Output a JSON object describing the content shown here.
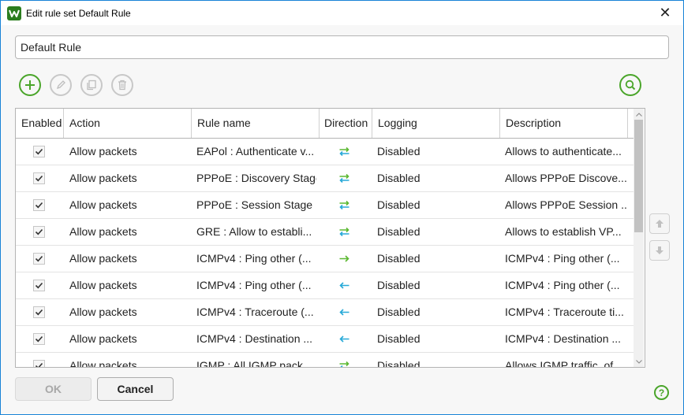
{
  "window": {
    "title": "Edit rule set Default Rule",
    "close_symbol": "✕"
  },
  "rule_set_name": {
    "value": "Default Rule"
  },
  "toolbar": {
    "add_icon": "plus-icon",
    "edit_icon": "pencil-icon",
    "copy_icon": "copy-icon",
    "delete_icon": "trash-icon",
    "search_icon": "search-icon"
  },
  "table": {
    "columns": [
      "Enabled",
      "Action",
      "Rule name",
      "Direction",
      "Logging",
      "Description"
    ],
    "rows": [
      {
        "enabled": true,
        "action": "Allow packets",
        "name": "EAPol : Authenticate v...",
        "direction": "both",
        "logging": "Disabled",
        "description": "Allows to authenticate..."
      },
      {
        "enabled": true,
        "action": "Allow packets",
        "name": "PPPoE : Discovery Stage",
        "direction": "both",
        "logging": "Disabled",
        "description": "Allows PPPoE Discove..."
      },
      {
        "enabled": true,
        "action": "Allow packets",
        "name": "PPPoE : Session Stage",
        "direction": "both",
        "logging": "Disabled",
        "description": "Allows PPPoE Session ..."
      },
      {
        "enabled": true,
        "action": "Allow packets",
        "name": "GRE : Allow to establi...",
        "direction": "both",
        "logging": "Disabled",
        "description": "Allows to establish VP..."
      },
      {
        "enabled": true,
        "action": "Allow packets",
        "name": "ICMPv4 : Ping other (...",
        "direction": "outgoing",
        "logging": "Disabled",
        "description": "ICMPv4 : Ping other (..."
      },
      {
        "enabled": true,
        "action": "Allow packets",
        "name": "ICMPv4 : Ping other (...",
        "direction": "incoming",
        "logging": "Disabled",
        "description": "ICMPv4 : Ping other (..."
      },
      {
        "enabled": true,
        "action": "Allow packets",
        "name": "ICMPv4 : Traceroute (...",
        "direction": "incoming",
        "logging": "Disabled",
        "description": "ICMPv4 : Traceroute ti..."
      },
      {
        "enabled": true,
        "action": "Allow packets",
        "name": "ICMPv4 : Destination ...",
        "direction": "incoming",
        "logging": "Disabled",
        "description": "ICMPv4 : Destination ..."
      },
      {
        "enabled": true,
        "action": "Allow packets",
        "name": "IGMP : All IGMP pack...",
        "direction": "both",
        "logging": "Disabled",
        "description": "Allows IGMP traffic, of..."
      }
    ]
  },
  "side_buttons": {
    "up_icon": "arrow-up-icon",
    "down_icon": "arrow-down-icon"
  },
  "buttons": {
    "ok": "OK",
    "cancel": "Cancel",
    "help": "?"
  },
  "colors": {
    "accent_green": "#4aa52a",
    "direction_green": "#5cb832",
    "direction_blue": "#27a9d8",
    "window_border": "#1883d7"
  }
}
